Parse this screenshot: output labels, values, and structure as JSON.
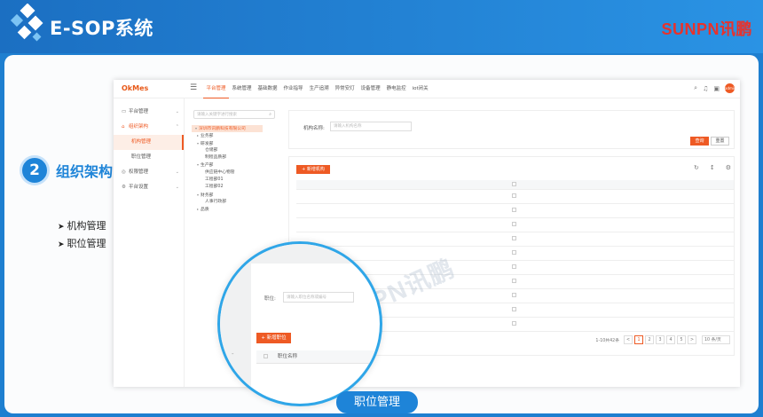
{
  "header": {
    "title": "E-SOP系统",
    "brand": "SUNPN讯鹏",
    "colors": {
      "blue": "#1e7fd0",
      "brand_red": "#e8322c",
      "accent": "#ee5a24"
    }
  },
  "section": {
    "number": "2",
    "title": "组织架构",
    "bullets": [
      "机构管理",
      "职位管理"
    ]
  },
  "app": {
    "logo": "OkMes",
    "top_nav": [
      "平台管理",
      "系统管理",
      "基础数据",
      "作业指导",
      "生产追溯",
      "异常安灯",
      "设备管理",
      "静电监控",
      "iot闭关"
    ],
    "top_nav_active": 0,
    "user_initials": "admin",
    "sidebar": [
      {
        "label": "平台管理",
        "icon": "monitor-icon",
        "expanded": false
      },
      {
        "label": "组织架构",
        "icon": "org-icon",
        "expanded": true,
        "children": [
          "机构管理",
          "职位管理"
        ],
        "active_child": 0
      },
      {
        "label": "权限管理",
        "icon": "lock-icon",
        "expanded": false
      },
      {
        "label": "平台设置",
        "icon": "settings-icon",
        "expanded": false
      }
    ],
    "tree": {
      "search_placeholder": "请输入关键字进行搜索",
      "root": "深圳市讯鹏科技有限公司",
      "nodes": [
        {
          "label": "业务部",
          "level": 1,
          "caret": true
        },
        {
          "label": "研发部",
          "level": 1,
          "caret": true
        },
        {
          "label": "仓储部",
          "level": 2,
          "caret": false
        },
        {
          "label": "制程品质部",
          "level": 2,
          "caret": false
        },
        {
          "label": "生产部",
          "level": 1,
          "caret": true
        },
        {
          "label": "供应链中心物管",
          "level": 2,
          "caret": false
        },
        {
          "label": "工程部01",
          "level": 2,
          "caret": false
        },
        {
          "label": "工程部02",
          "level": 2,
          "caret": false
        },
        {
          "label": "财务部",
          "level": 1,
          "caret": true
        },
        {
          "label": "人事行政部",
          "level": 2,
          "caret": false
        },
        {
          "label": "品质",
          "level": 1,
          "caret": true
        }
      ]
    },
    "filter": {
      "label": "机构名称:",
      "placeholder": "请输入机构名称",
      "query_button": "查询",
      "reset_button": "重置"
    },
    "table": {
      "add_button": "+ 新增机构",
      "row_count": 10,
      "pagination": {
        "total_text": "1-10共42条",
        "pages": [
          "<",
          "1",
          "2",
          "3",
          "4",
          "5",
          ">"
        ],
        "current": "1",
        "page_size": "10 条/页"
      }
    },
    "watermark": "SUNPN讯鹏"
  },
  "zoom": {
    "label": "职位:",
    "placeholder": "请输入职位名称或编号",
    "add_button": "+ 新增职位",
    "column_header": "职位名称",
    "dash": "-",
    "callout": "职位管理"
  }
}
